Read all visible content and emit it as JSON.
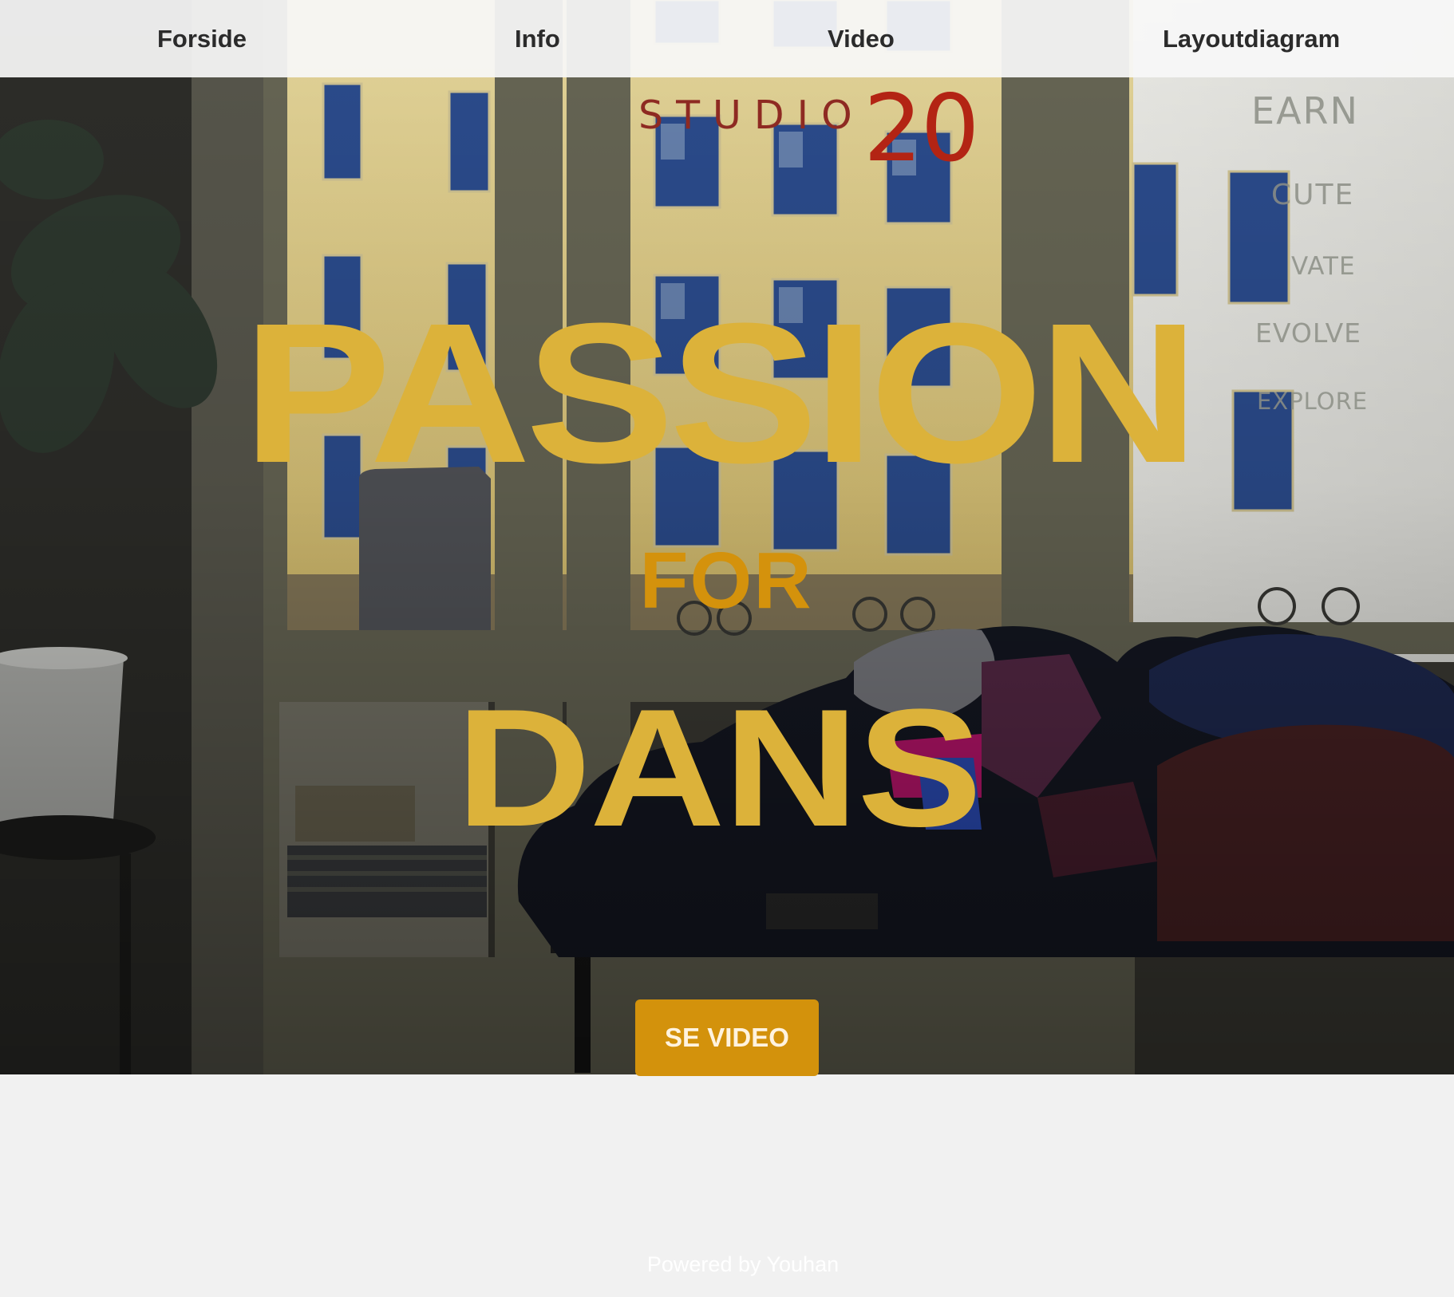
{
  "nav": {
    "items": [
      {
        "label": "Forside"
      },
      {
        "label": "Info"
      },
      {
        "label": "Video"
      },
      {
        "label": "Layoutdiagram"
      }
    ]
  },
  "logo": {
    "studio": "STUDIO",
    "number": "20"
  },
  "wall_words": [
    "LEARN",
    "EXECUTE",
    "ELEVATE",
    "EVOLVE",
    "EXPLORE"
  ],
  "wall_words_visible": [
    "EARN",
    "CUTE",
    "VATE",
    "EVOLVE",
    "EXPLORE"
  ],
  "headline": {
    "line1": "PASSION",
    "line2": "FOR",
    "line3": "DANS"
  },
  "cta": {
    "label": "SE VIDEO"
  },
  "footer": {
    "text": "Powered by Youhan"
  },
  "colors": {
    "headline": "#dcb23a",
    "for": "#d4920c",
    "cta_bg": "#d3920c",
    "logo_red": "#b32414",
    "nav_bg": "#f7f7f7",
    "page_bg": "#f1f1f1"
  }
}
